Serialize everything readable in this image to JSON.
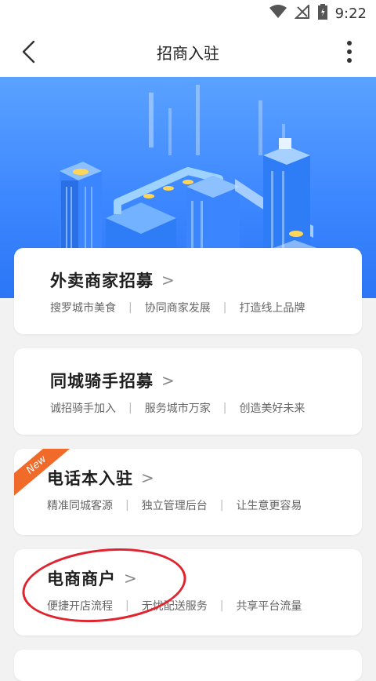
{
  "status_bar": {
    "time": "9:22"
  },
  "app_bar": {
    "title": "招商入驻"
  },
  "colors": {
    "hero_blue": "#3d87ff",
    "new_badge": "#f06b2a",
    "annotation_red": "#e0232f"
  },
  "cards": [
    {
      "title": "外卖商家招募",
      "chevron": ">",
      "tags": [
        "搜罗城市美食",
        "协同商家发展",
        "打造线上品牌"
      ]
    },
    {
      "title": "同城骑手招募",
      "chevron": ">",
      "tags": [
        "诚招骑手加入",
        "服务城市万家",
        "创造美好未来"
      ]
    },
    {
      "title": "电话本入驻",
      "chevron": ">",
      "badge": "New",
      "tags": [
        "精准同城客源",
        "独立管理后台",
        "让生意更容易"
      ]
    },
    {
      "title": "电商商户",
      "chevron": ">",
      "tags": [
        "便捷开店流程",
        "无忧配送服务",
        "共享平台流量"
      ]
    }
  ],
  "icons": [
    "wifi-icon",
    "signal-icon",
    "battery-icon",
    "back-arrow-icon",
    "more-vert-icon"
  ]
}
